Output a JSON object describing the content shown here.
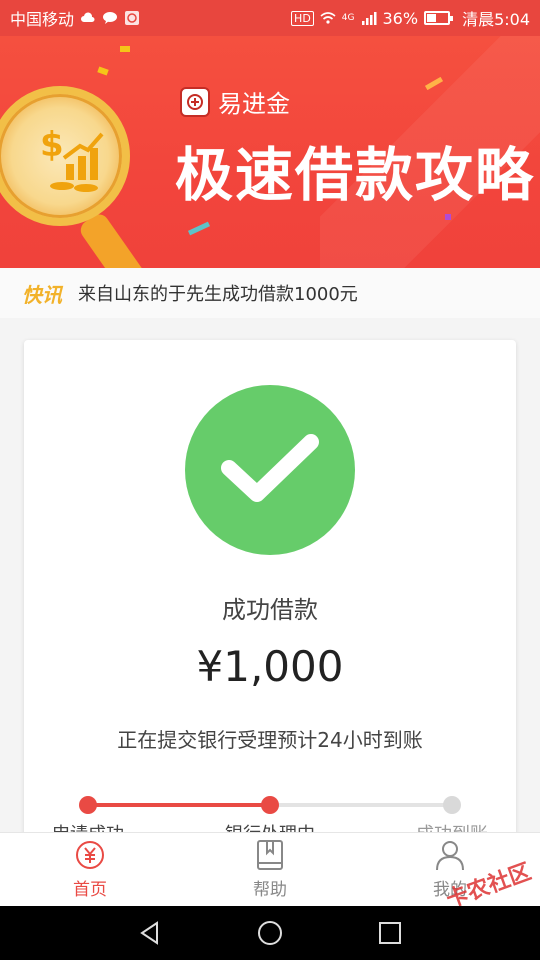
{
  "status_bar": {
    "carrier": "中国移动",
    "hd": "HD",
    "network": "4G",
    "battery": "36%",
    "time": "清晨5:04"
  },
  "banner": {
    "logo_text": "易进金",
    "title": "极速借款攻略"
  },
  "ticker": {
    "tag": "快讯",
    "text": "来自山东的于先生成功借款1000元"
  },
  "result": {
    "title": "成功借款",
    "amount": "¥1,000",
    "note": "正在提交银行受理预计24小时到账"
  },
  "progress": {
    "fraction_complete": 0.5,
    "steps": [
      {
        "label": "申请成功",
        "state": "done"
      },
      {
        "label": "银行处理中",
        "state": "current"
      },
      {
        "label": "成功到账",
        "state": "pending"
      }
    ]
  },
  "bottom_nav": {
    "items": [
      {
        "label": "首页",
        "icon": "yuan-circle-icon",
        "active": true
      },
      {
        "label": "帮助",
        "icon": "book-icon",
        "active": false
      },
      {
        "label": "我的",
        "icon": "person-icon",
        "active": false
      }
    ]
  },
  "watermark": "卡农社区",
  "colors": {
    "brand_red": "#e94a44",
    "success_green": "#66cc6a",
    "ticker_tag": "#f2b22a"
  }
}
